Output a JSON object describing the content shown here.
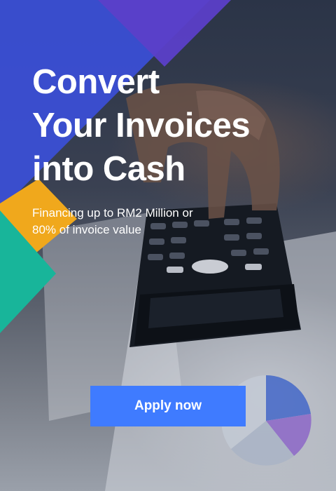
{
  "banner": {
    "headline_lines": [
      "Convert",
      "Your Invoices",
      "into Cash"
    ],
    "subhead_lines": [
      "Financing up to RM2 Million or",
      "80% of invoice value"
    ],
    "cta_label": "Apply now"
  },
  "colors": {
    "blue_shape": "#3b4fd8",
    "purple_shape": "#5b3fc8",
    "yellow_shape": "#f0a81c",
    "teal_shape": "#18b59a",
    "cta_background": "#3f7bff",
    "text": "#ffffff"
  }
}
